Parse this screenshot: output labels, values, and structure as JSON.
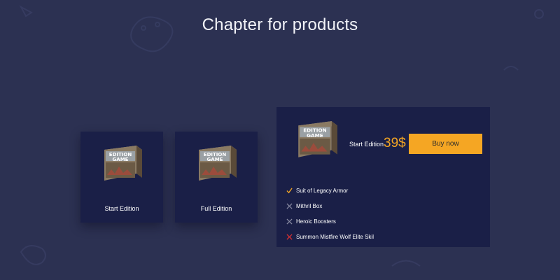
{
  "page": {
    "title": "Chapter for products"
  },
  "box_art": {
    "line1": "EDITION",
    "line2": "GAME"
  },
  "colors": {
    "background": "#2c3152",
    "card": "#1a1f47",
    "accent": "#f5a623",
    "included": "#f5a623",
    "excluded": "#8a8ca3",
    "locked": "#e03131"
  },
  "cards": [
    {
      "label": "Start Edition"
    },
    {
      "label": "Full Edition"
    }
  ],
  "detail": {
    "edition_name": "Start Edition",
    "price": "39$",
    "buy_label": "Buy now",
    "features": [
      {
        "label": "Suit of Legacy Armor",
        "status": "included",
        "icon": "check-icon"
      },
      {
        "label": "Mithril Box",
        "status": "excluded",
        "icon": "cross-icon"
      },
      {
        "label": "Heroic Boosters",
        "status": "excluded",
        "icon": "cross-icon"
      },
      {
        "label": "Summon Mistfire Wolf Elite Skil",
        "status": "locked",
        "icon": "cross-red-icon"
      }
    ]
  }
}
